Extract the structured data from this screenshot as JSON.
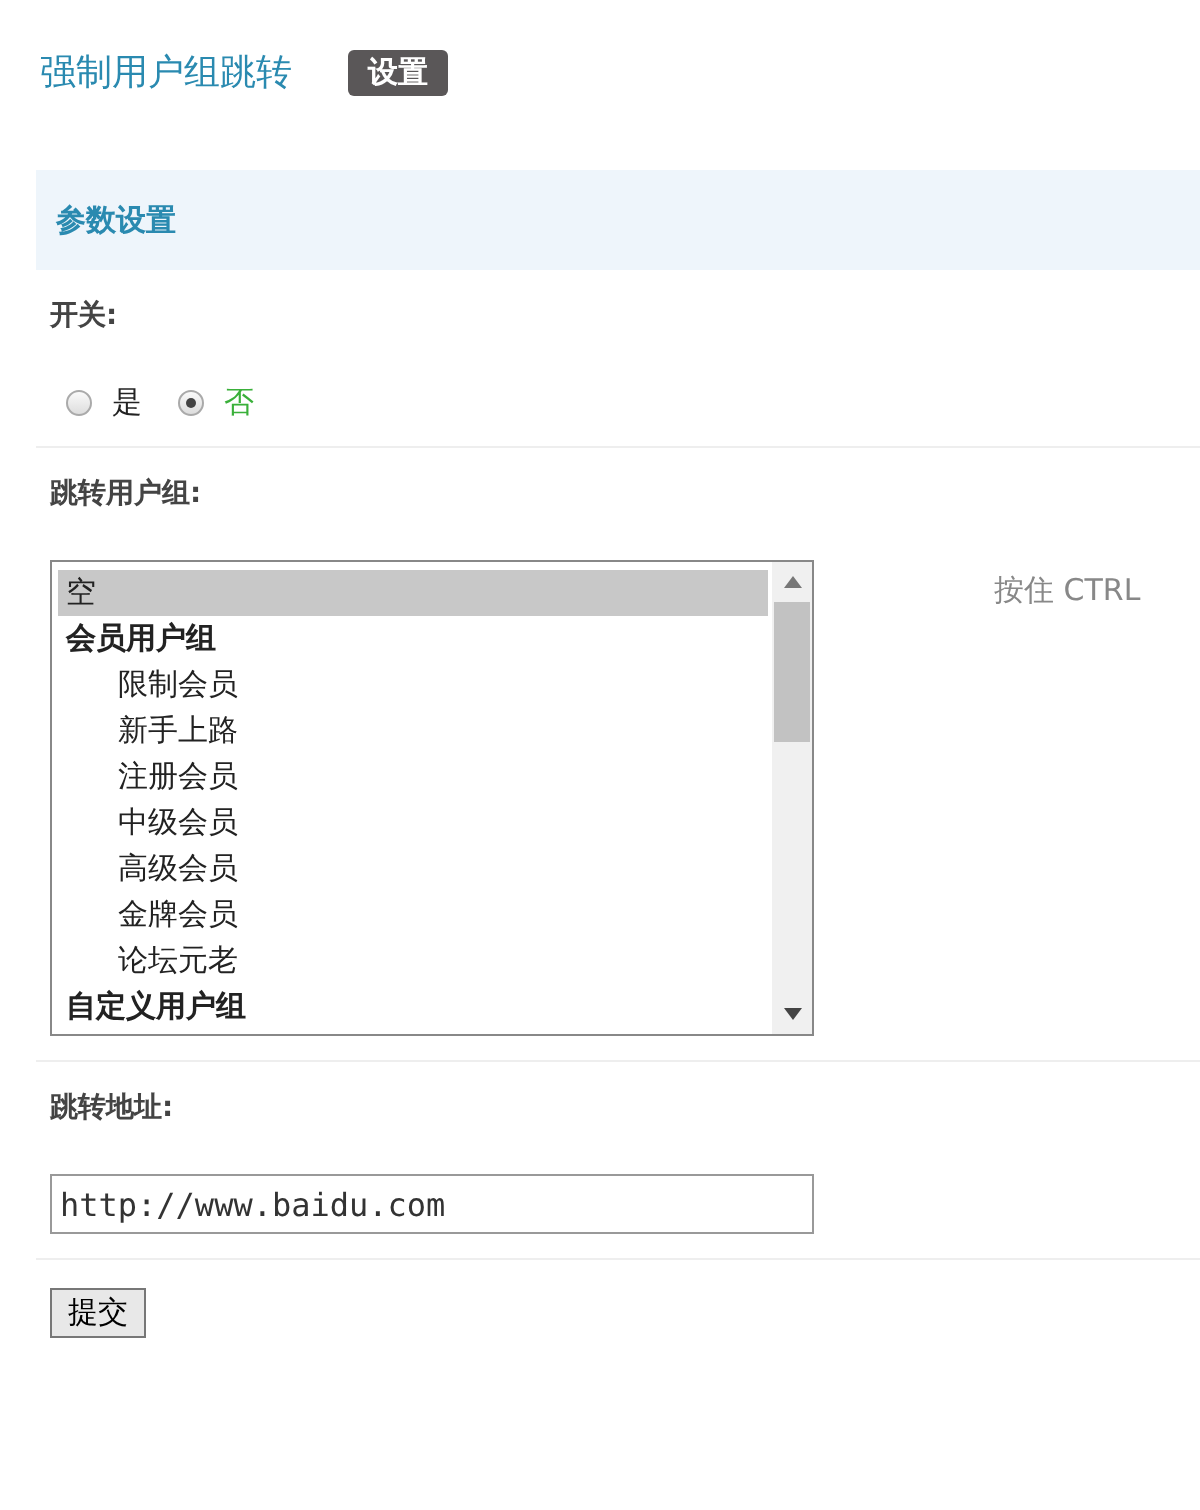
{
  "header": {
    "title": "强制用户组跳转",
    "button": "设置"
  },
  "section": {
    "title": "参数设置"
  },
  "switch": {
    "label": "开关:",
    "options": [
      {
        "label": "是",
        "selected": false
      },
      {
        "label": "否",
        "selected": true
      }
    ]
  },
  "groups": {
    "label": "跳转用户组:",
    "hint": "按住 CTRL",
    "items": [
      {
        "kind": "option",
        "label": "空",
        "selected": true
      },
      {
        "kind": "group",
        "label": "会员用户组",
        "selected": false
      },
      {
        "kind": "option",
        "label": "限制会员",
        "selected": false
      },
      {
        "kind": "option",
        "label": "新手上路",
        "selected": false
      },
      {
        "kind": "option",
        "label": "注册会员",
        "selected": false
      },
      {
        "kind": "option",
        "label": "中级会员",
        "selected": false
      },
      {
        "kind": "option",
        "label": "高级会员",
        "selected": false
      },
      {
        "kind": "option",
        "label": "金牌会员",
        "selected": false
      },
      {
        "kind": "option",
        "label": "论坛元老",
        "selected": false
      },
      {
        "kind": "group",
        "label": "自定义用户组",
        "selected": false
      }
    ]
  },
  "address": {
    "label": "跳转地址:",
    "value": "http://www.baidu.com"
  },
  "submit": {
    "label": "提交"
  }
}
